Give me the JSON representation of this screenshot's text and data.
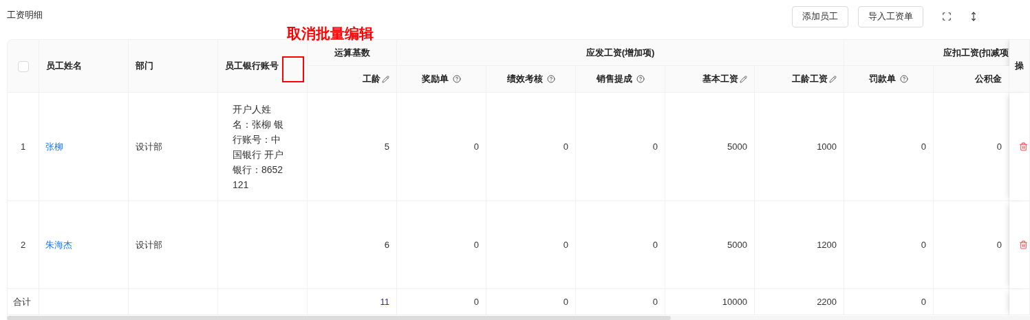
{
  "title": "工资明细",
  "buttons": [
    {
      "label": "添加员工"
    },
    {
      "label": "导入工资单"
    }
  ],
  "annotation": {
    "text": "取消批量编辑"
  },
  "table": {
    "select_all": {
      "checked": false
    },
    "fixed_columns": [
      "员工姓名",
      "部门",
      "员工银行账号"
    ],
    "groups": [
      "运算基数",
      "应发工资(增加项)",
      "应扣工资(扣减项"
    ],
    "columns": [
      {
        "label": "工龄",
        "kind": "editable"
      },
      {
        "label": "奖励单",
        "kind": "info"
      },
      {
        "label": "绩效考核",
        "kind": "info"
      },
      {
        "label": "销售提成",
        "kind": "info"
      },
      {
        "label": "基本工资",
        "kind": "editable"
      },
      {
        "label": "工龄工资",
        "kind": "editable"
      },
      {
        "label": "罚款单",
        "kind": "info"
      },
      {
        "label": "公积金",
        "kind": "plain"
      }
    ],
    "action_column": "操",
    "rows": [
      {
        "index": "1",
        "name": "张柳",
        "department": "设计部",
        "bank": "开户人姓名：张柳 银行账号：中国银行 开户银行：8652121",
        "values": [
          "5",
          "0",
          "0",
          "0",
          "5000",
          "1000",
          "0",
          "0"
        ]
      },
      {
        "index": "2",
        "name": "朱海杰",
        "department": "设计部",
        "values": [
          "6",
          "0",
          "0",
          "0",
          "5000",
          "1200",
          "0",
          "0"
        ]
      }
    ],
    "totals": {
      "label": "合计",
      "values": [
        "11",
        "0",
        "0",
        "0",
        "10000",
        "2200",
        "0"
      ]
    }
  }
}
